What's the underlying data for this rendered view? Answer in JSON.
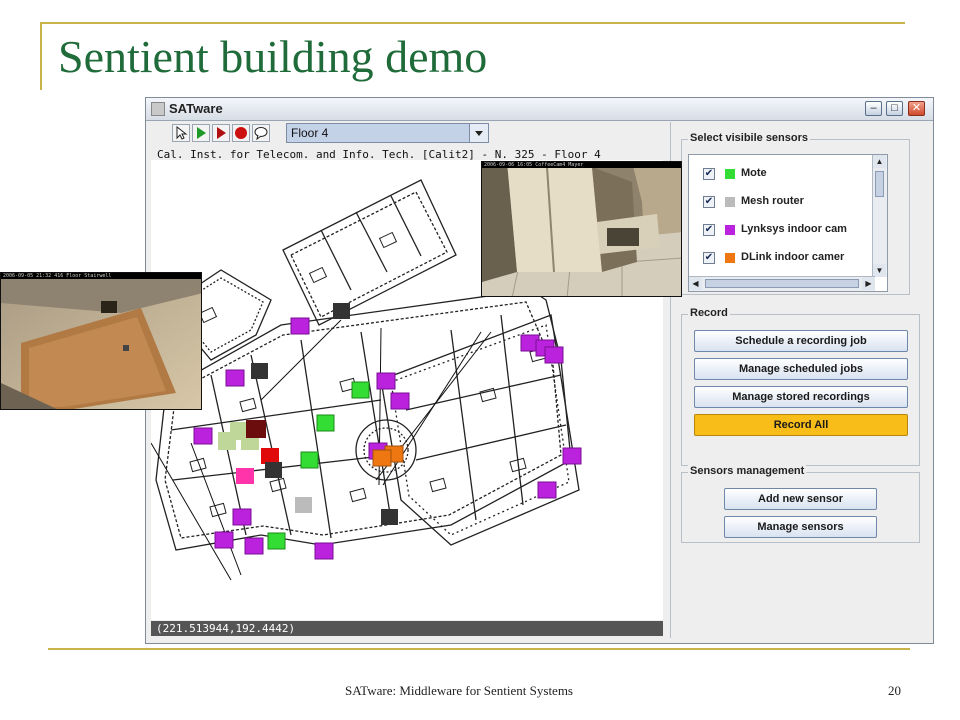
{
  "slide": {
    "title": "Sentient building demo",
    "footer": "SATware: Middleware for Sentient Systems",
    "page_number": "20"
  },
  "window": {
    "title": "SATware",
    "controls": [
      "minimize",
      "maximize",
      "close"
    ]
  },
  "toolbar": {
    "tools": [
      "pointer-icon",
      "play-icon",
      "play-record-icon",
      "record-icon",
      "speech-bubble-icon"
    ],
    "floor_value": "Floor 4"
  },
  "map": {
    "title": "Cal. Inst. for Telecom. and Info. Tech. [Calit2] - N. 325 - Floor 4",
    "coords": "(221.513944,192.4442)"
  },
  "sensors_panel": {
    "title": "Select visibile sensors",
    "items": [
      {
        "label": "Mote",
        "color": "#33dd33",
        "checked": true
      },
      {
        "label": "Mesh router",
        "color": "#bbbbbb",
        "checked": true
      },
      {
        "label": "Lynksys indoor cam",
        "color": "#bb22dd",
        "checked": true
      },
      {
        "label": "DLink indoor camer",
        "color": "#ee7711",
        "checked": true
      }
    ]
  },
  "record": {
    "title": "Record",
    "schedule": "Schedule a recording job",
    "manage_jobs": "Manage scheduled jobs",
    "manage_recordings": "Manage stored recordings",
    "record_all": "Record All"
  },
  "management": {
    "title": "Sensors management",
    "add": "Add new sensor",
    "manage": "Manage sensors"
  },
  "cameras": {
    "left_timestamp": "2006-09-05 21:32",
    "left_label": "416 Floor Stairwell",
    "right_timestamp": "2006-09-06 16:05",
    "right_label": "CoffeeCam4 Mayer"
  },
  "colors": {
    "title_green": "#1f6b3a",
    "accent_gold": "#c8b24a",
    "record_all": "#f8bd18",
    "mote": "#33dd33",
    "mesh_router": "#bbbbbb",
    "lynksys_cam": "#bb22dd",
    "dlink_cam": "#ee7711"
  }
}
